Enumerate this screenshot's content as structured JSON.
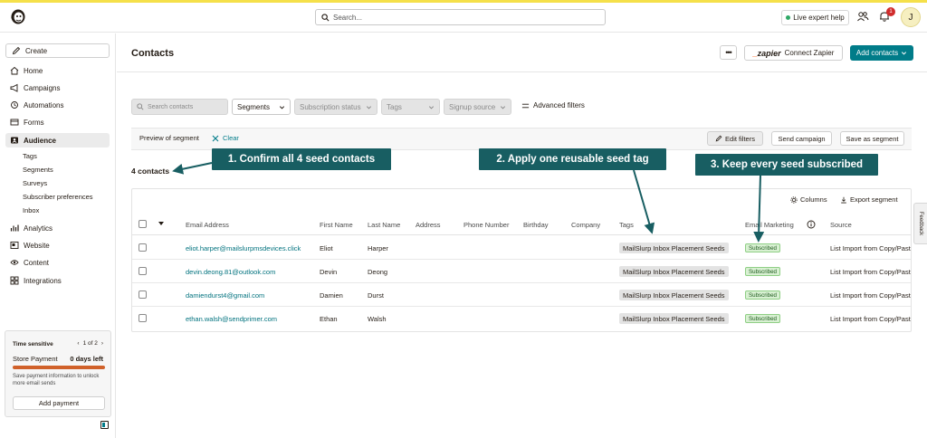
{
  "topbar": {
    "search_placeholder": "Search...",
    "expert_help": "Live expert help",
    "notification_count": "1",
    "avatar_initial": "J",
    "accent_color": "#f5e04a"
  },
  "sidebar": {
    "create": "Create",
    "items": [
      {
        "label": "Home",
        "icon": "home-icon"
      },
      {
        "label": "Campaigns",
        "icon": "megaphone-icon"
      },
      {
        "label": "Automations",
        "icon": "automation-icon"
      },
      {
        "label": "Forms",
        "icon": "forms-icon"
      },
      {
        "label": "Audience",
        "icon": "audience-icon",
        "active": true
      },
      {
        "label": "Analytics",
        "icon": "analytics-icon"
      },
      {
        "label": "Website",
        "icon": "website-icon"
      },
      {
        "label": "Content",
        "icon": "content-icon"
      },
      {
        "label": "Integrations",
        "icon": "integrations-icon"
      }
    ],
    "audience_sub": [
      "Tags",
      "Segments",
      "Surveys",
      "Subscriber preferences",
      "Inbox"
    ],
    "time_sensitive": {
      "label": "Time sensitive",
      "pager": "1 of 2",
      "title": "Store Payment",
      "days_left": "0 days left",
      "progress": 1.0,
      "description": "Save payment information to unlock more email sends",
      "button": "Add payment"
    }
  },
  "header": {
    "title": "Contacts",
    "more": "•••",
    "zapier_logo": "zapier",
    "connect_zapier": "Connect Zapier",
    "add_contacts": "Add contacts",
    "accent_color": "#007c89"
  },
  "filters": {
    "search_placeholder": "Search contacts",
    "segments": "Segments",
    "subscription_status": "Subscription status",
    "tags": "Tags",
    "signup_source": "Signup source",
    "advanced": "Advanced filters"
  },
  "segment_bar": {
    "preview": "Preview of segment",
    "clear": "Clear",
    "edit_filters": "Edit filters",
    "send_campaign": "Send campaign",
    "save_as_segment": "Save as segment"
  },
  "count": "4 contacts",
  "callouts": {
    "one": "1. Confirm all 4 seed contacts",
    "two": "2. Apply one reusable seed tag",
    "three": "3. Keep every seed subscribed",
    "color": "#185e62"
  },
  "table": {
    "columns_btn": "Columns",
    "export_btn": "Export segment",
    "headers": [
      "Email Address",
      "First Name",
      "Last Name",
      "Address",
      "Phone Number",
      "Birthday",
      "Company",
      "Tags",
      "Email Marketing",
      "Source"
    ],
    "rows": [
      {
        "email": "eliot.harper@mailslurpmsdevices.click",
        "first": "Eliot",
        "last": "Harper",
        "tag": "MailSlurp Inbox Placement Seeds",
        "status": "Subscribed",
        "source": "List Import from Copy/Paste"
      },
      {
        "email": "devin.deong.81@outlook.com",
        "first": "Devin",
        "last": "Deong",
        "tag": "MailSlurp Inbox Placement Seeds",
        "status": "Subscribed",
        "source": "List Import from Copy/Paste"
      },
      {
        "email": "damiendurst4@gmail.com",
        "first": "Damien",
        "last": "Durst",
        "tag": "MailSlurp Inbox Placement Seeds",
        "status": "Subscribed",
        "source": "List Import from Copy/Paste"
      },
      {
        "email": "ethan.walsh@sendprimer.com",
        "first": "Ethan",
        "last": "Walsh",
        "tag": "MailSlurp Inbox Placement Seeds",
        "status": "Subscribed",
        "source": "List Import from Copy/Paste"
      }
    ]
  },
  "feedback": "Feedback"
}
